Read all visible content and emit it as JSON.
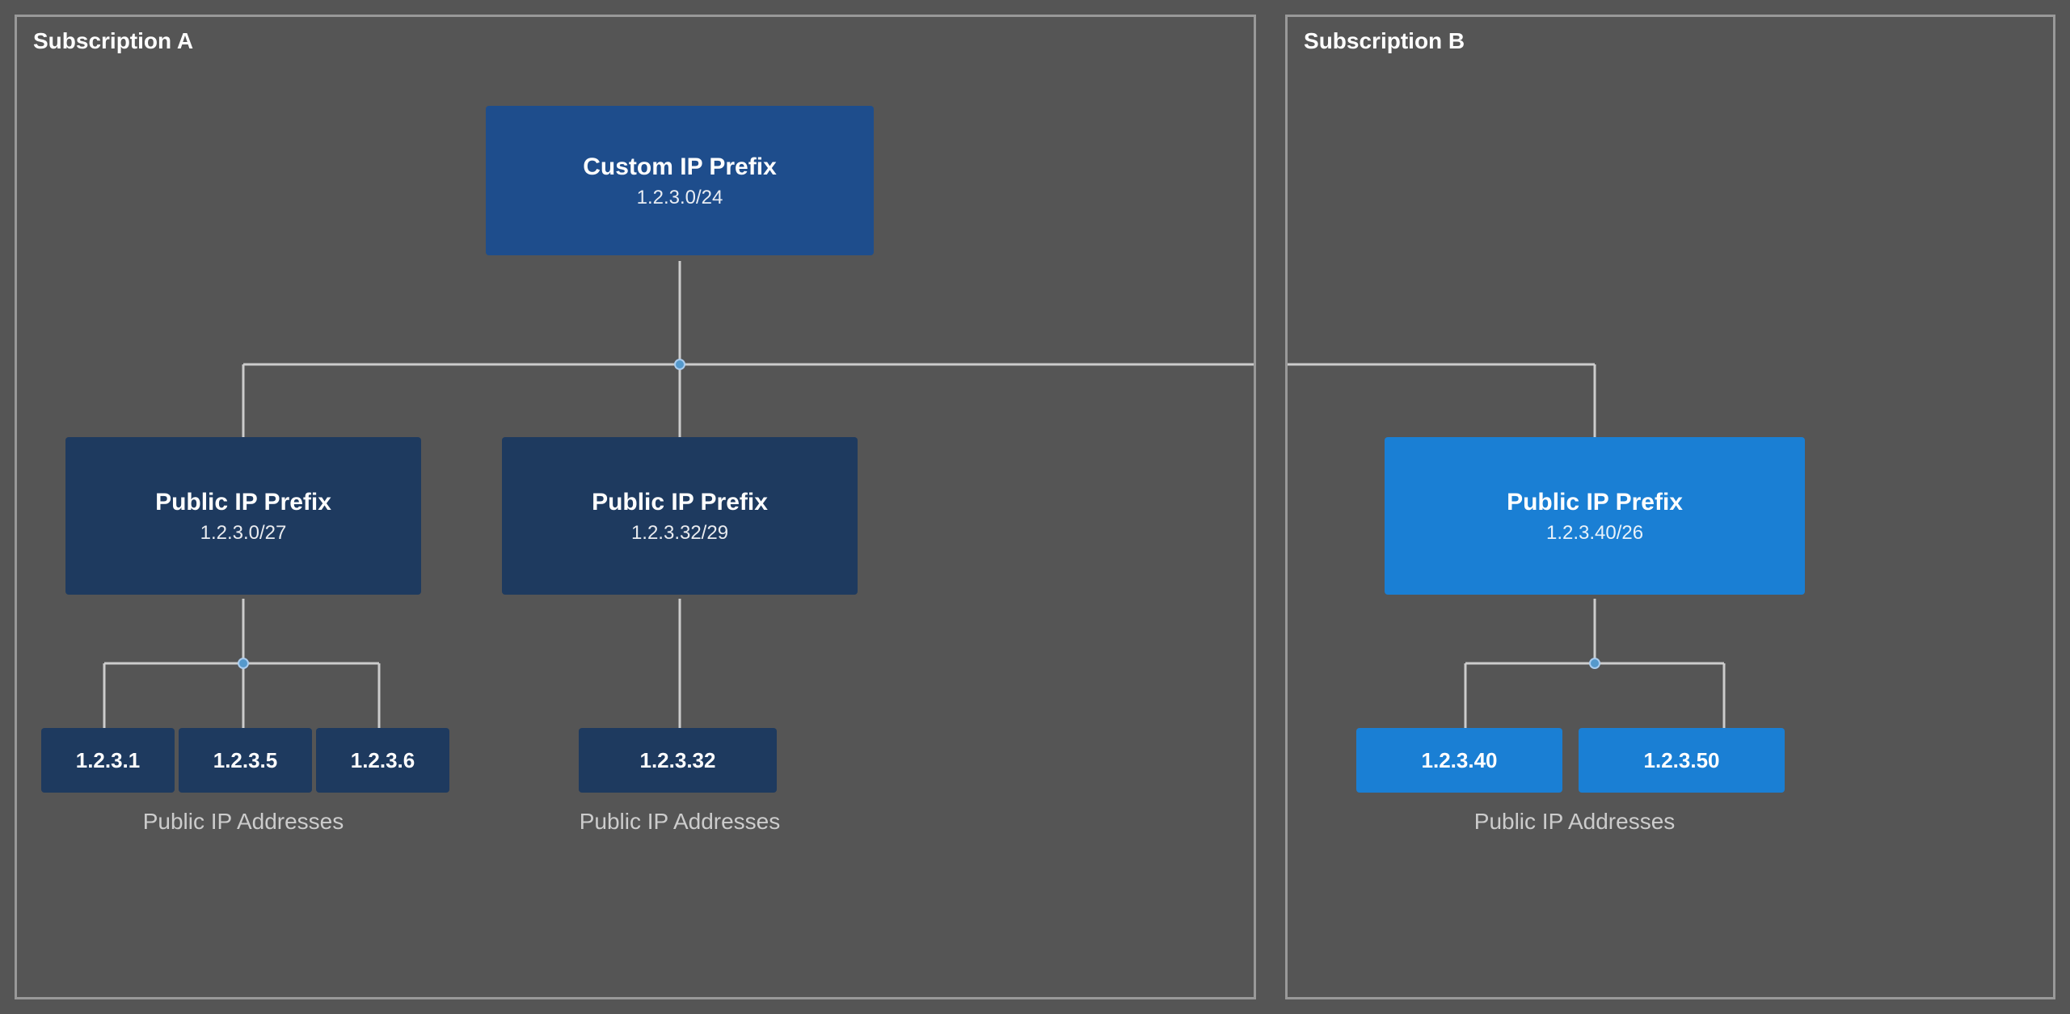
{
  "subscriptionA": {
    "label": "Subscription A",
    "customIPPrefix": {
      "title": "Custom IP Prefix",
      "subtitle": "1.2.3.0/24"
    },
    "prefixLeft": {
      "title": "Public IP Prefix",
      "subtitle": "1.2.3.0/27"
    },
    "prefixMiddle": {
      "title": "Public IP Prefix",
      "subtitle": "1.2.3.32/29"
    },
    "ipsLeft": [
      "1.2.3.1",
      "1.2.3.5",
      "1.2.3.6"
    ],
    "ipMiddle": "1.2.3.32",
    "publicIPLabel": "Public IP Addresses"
  },
  "subscriptionB": {
    "label": "Subscription B",
    "prefixRight": {
      "title": "Public IP Prefix",
      "subtitle": "1.2.3.40/26"
    },
    "ipsRight": [
      "1.2.3.40",
      "1.2.3.50"
    ],
    "publicIPLabel": "Public IP Addresses"
  }
}
